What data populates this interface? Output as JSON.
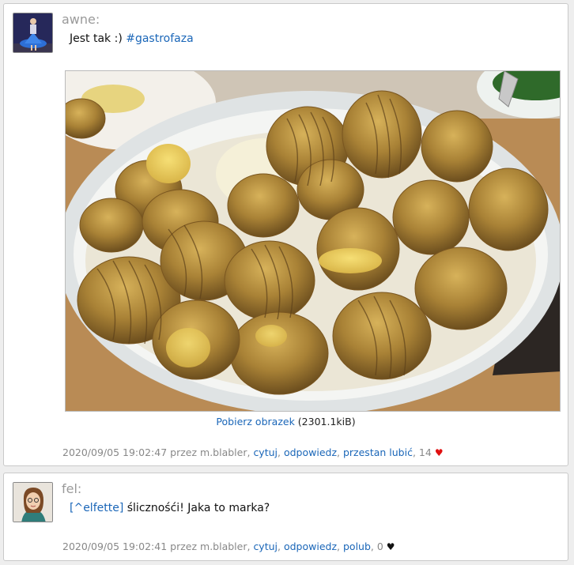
{
  "posts": [
    {
      "author": "awne:",
      "text": "Jest tak :)",
      "hashtag": "#gastrofaza",
      "download_link": "Pobierz obrazek",
      "download_size": "(2301.1kiB)",
      "timestamp": "2020/09/05 19:02:47",
      "by_label": "przez m.blabler,",
      "actions": [
        "cytuj",
        "odpowiedz",
        "przestan lubić"
      ],
      "likes": "14",
      "heart_color": "#e01010"
    },
    {
      "author": "fel:",
      "mention": "[^elfette]",
      "text": "ślicznośći! Jaka to marka?",
      "timestamp": "2020/09/05 19:02:41",
      "by_label": "przez m.blabler,",
      "actions": [
        "cytuj",
        "odpowiedz",
        "polub"
      ],
      "likes": "0",
      "heart_color": "#111111"
    }
  ],
  "colors": {
    "link": "#1a66b8",
    "meta": "#888888",
    "author": "#9a9a9a"
  }
}
